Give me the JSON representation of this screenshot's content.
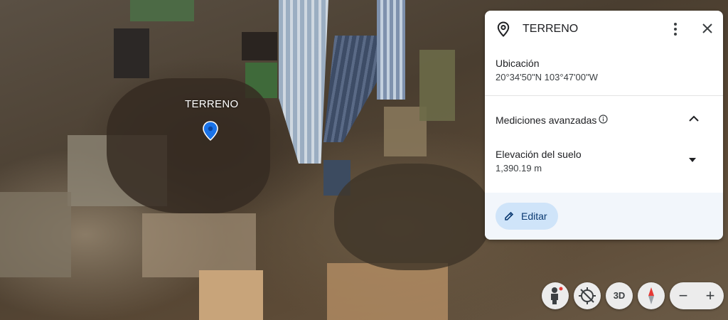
{
  "map": {
    "marker_label": "TERRENO"
  },
  "panel": {
    "title": "TERRENO",
    "location_label": "Ubicación",
    "location_value": "20°34'50\"N 103°47'00\"W",
    "advanced_label": "Mediciones avanzadas",
    "elevation_label": "Elevación del suelo",
    "elevation_value": "1,390.19 m",
    "edit_label": "Editar"
  },
  "controls": {
    "view_3d_label": "3D",
    "zoom_out_symbol": "−",
    "zoom_in_symbol": "+"
  },
  "icons": {
    "location": "location-pin-icon",
    "more": "more-vert-icon",
    "close": "close-icon",
    "info": "info-icon",
    "collapse": "chevron-up-icon",
    "dropdown": "caret-down-icon",
    "edit": "pencil-icon",
    "street_view": "pegman-icon",
    "no_tilt": "tilt-icon",
    "compass": "compass-icon"
  },
  "colors": {
    "marker": "#1a73e8",
    "edit_button_bg": "#cfe4f9",
    "compass_north": "#e53935"
  }
}
